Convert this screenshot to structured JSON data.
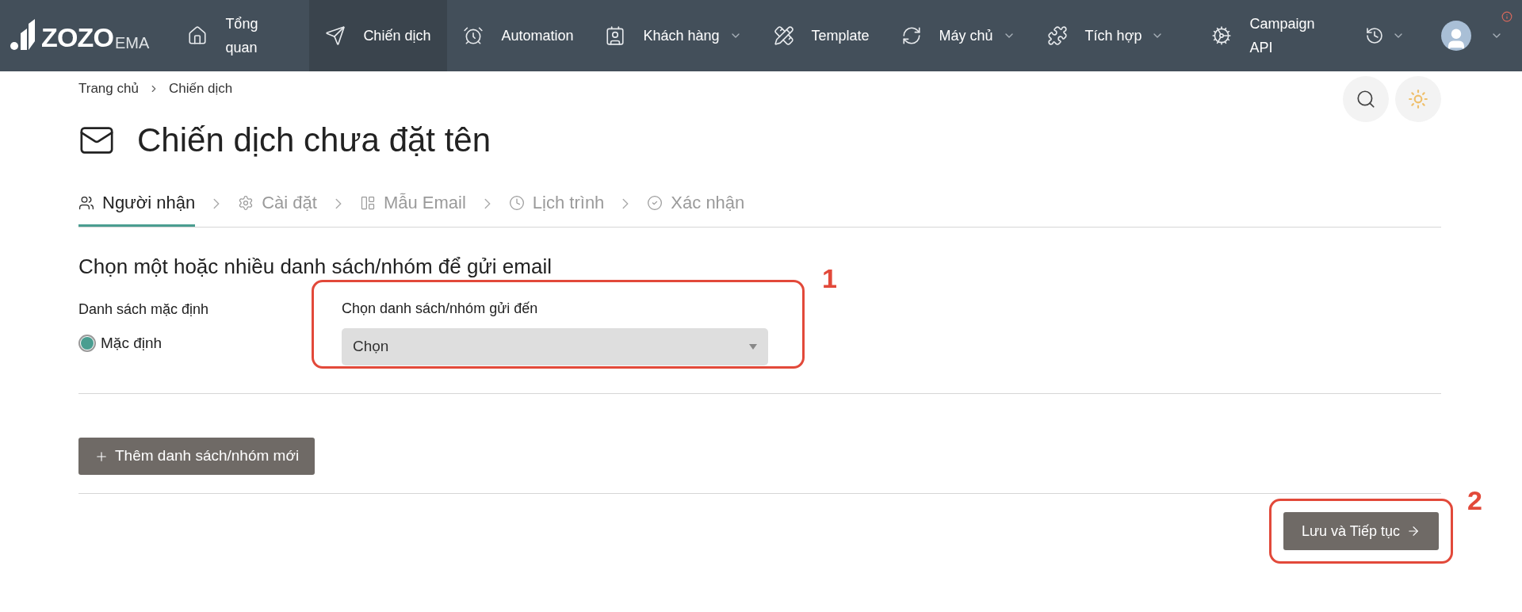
{
  "nav": {
    "logo": {
      "brand": "ZOZO",
      "suffix": "EMA"
    },
    "items": [
      {
        "label": "Tổng quan",
        "selected": false,
        "dropdown": false
      },
      {
        "label": "Chiến dịch",
        "selected": true,
        "dropdown": false
      },
      {
        "label": "Automation",
        "selected": false,
        "dropdown": false
      },
      {
        "label": "Khách hàng",
        "selected": false,
        "dropdown": true
      },
      {
        "label": "Template",
        "selected": false,
        "dropdown": false
      },
      {
        "label": "Máy chủ",
        "selected": false,
        "dropdown": true
      },
      {
        "label": "Tích hợp",
        "selected": false,
        "dropdown": true
      },
      {
        "label": "Campaign API",
        "selected": false,
        "dropdown": false
      }
    ]
  },
  "breadcrumb": [
    "Trang chủ",
    "Chiến dịch"
  ],
  "title": "Chiến dịch chưa đặt tên",
  "steps": [
    {
      "label": "Người nhận",
      "selected": true
    },
    {
      "label": "Cài đặt",
      "selected": false
    },
    {
      "label": "Mẫu Email",
      "selected": false
    },
    {
      "label": "Lịch trình",
      "selected": false
    },
    {
      "label": "Xác nhận",
      "selected": false
    }
  ],
  "section_heading": "Chọn một hoặc nhiều danh sách/nhóm để gửi email",
  "default_list": {
    "label": "Danh sách mặc định",
    "option": {
      "label": "Mặc định",
      "checked": true
    }
  },
  "target_select": {
    "label": "Chọn danh sách/nhóm gửi đến",
    "placeholder": "Chọn"
  },
  "add_button": "Thêm danh sách/nhóm mới",
  "save_button": "Lưu và Tiếp tục",
  "annotations": [
    "1",
    "2"
  ]
}
